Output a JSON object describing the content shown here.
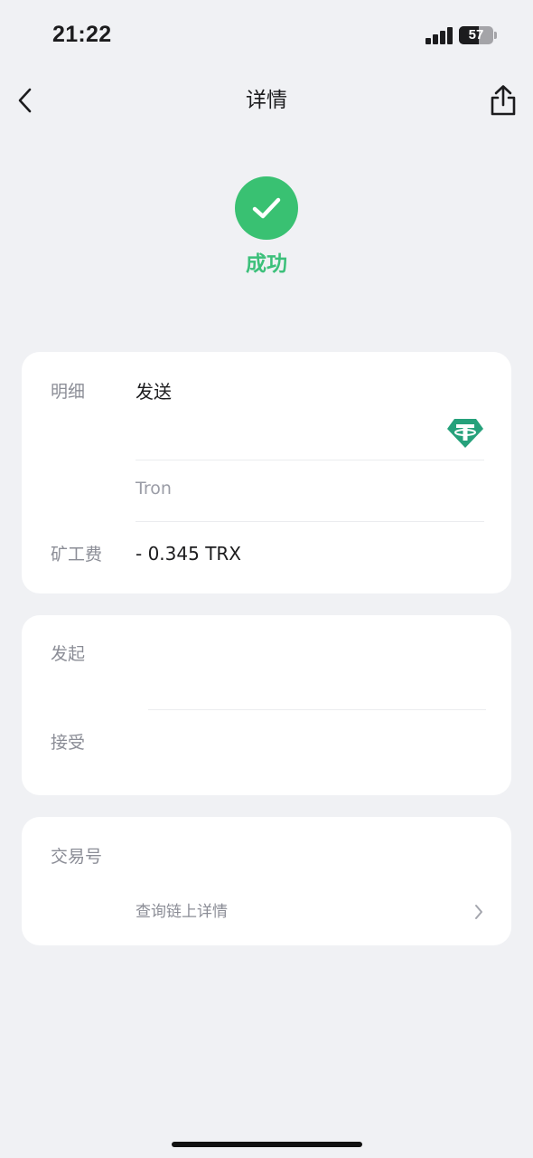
{
  "status_bar": {
    "time": "21:22",
    "battery_level": "57",
    "battery_percent": 57
  },
  "nav": {
    "title": "详情",
    "back_icon": "chevron-left-icon",
    "share_icon": "share-icon"
  },
  "status": {
    "label": "成功",
    "icon": "checkmark-icon",
    "color": "#39c172"
  },
  "details_card": {
    "detail_label": "明细",
    "detail_value": "发送",
    "token_icon": "tether-usdt-icon",
    "token_color": "#26a17b",
    "network": "Tron",
    "fee_label": "矿工费",
    "fee_value": "- 0.345 TRX"
  },
  "parties_card": {
    "from_label": "发起",
    "to_label": "接受"
  },
  "tx_card": {
    "tx_label": "交易号",
    "explorer_link": "查询链上详情"
  }
}
